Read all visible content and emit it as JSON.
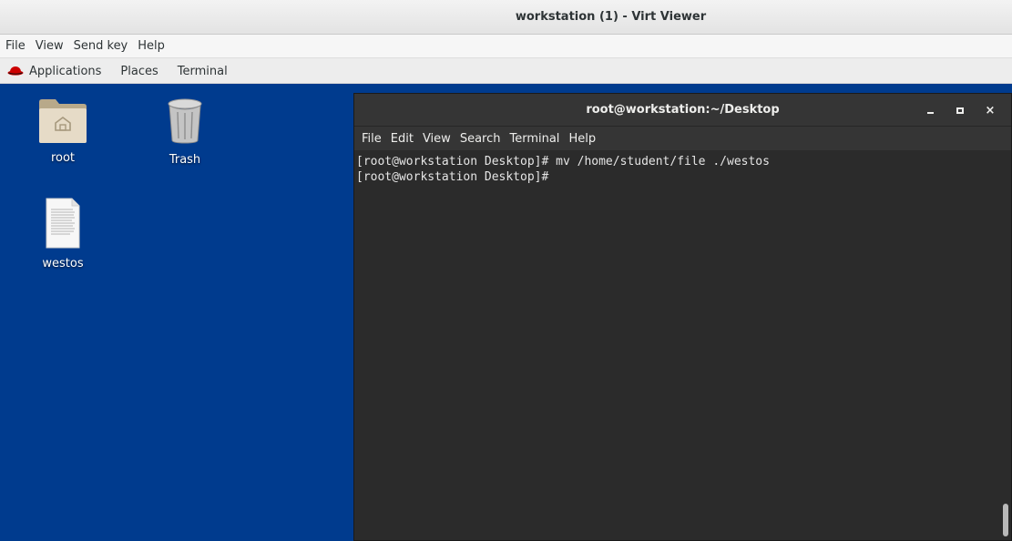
{
  "window": {
    "title": "workstation (1) - Virt Viewer"
  },
  "viewer_menu": [
    "File",
    "View",
    "Send key",
    "Help"
  ],
  "guest_topbar": {
    "applications": "Applications",
    "places": "Places",
    "terminal": "Terminal"
  },
  "desktop": {
    "background": "#003b8e",
    "icons": [
      {
        "label": "root",
        "icon": "home-folder-icon"
      },
      {
        "label": "Trash",
        "icon": "trash-icon"
      },
      {
        "label": "westos",
        "icon": "text-file-icon"
      }
    ]
  },
  "terminal": {
    "title": "root@workstation:~/Desktop",
    "menu": [
      "File",
      "Edit",
      "View",
      "Search",
      "Terminal",
      "Help"
    ],
    "lines": [
      "[root@workstation Desktop]# mv /home/student/file ./westos",
      "[root@workstation Desktop]# "
    ],
    "controls": {
      "minimize": "minimize-icon",
      "maximize": "maximize-icon",
      "close": "×"
    }
  }
}
